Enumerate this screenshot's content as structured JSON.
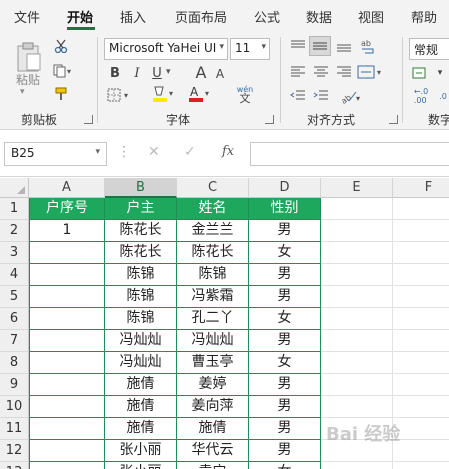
{
  "ribbon_tabs": [
    "文件",
    "开始",
    "插入",
    "页面布局",
    "公式",
    "数据",
    "视图",
    "帮助"
  ],
  "active_tab": "开始",
  "clipboard": {
    "paste_label": "粘贴",
    "group_label": "剪贴板"
  },
  "font": {
    "name": "Microsoft YaHei UI",
    "size": "11",
    "group_label": "字体",
    "bold": "B",
    "italic": "I",
    "underline": "U",
    "grow": "A",
    "shrink": "A",
    "phonetic": "wén"
  },
  "alignment": {
    "group_label": "对齐方式"
  },
  "number": {
    "format": "常规",
    "group_label": "数字"
  },
  "formula_bar": {
    "name_box": "B25",
    "formula": ""
  },
  "columns": [
    "A",
    "B",
    "C",
    "D",
    "E",
    "F"
  ],
  "selected_column": "B",
  "rows": [
    "1",
    "2",
    "3",
    "4",
    "5",
    "6",
    "7",
    "8",
    "9",
    "10",
    "11",
    "12",
    "13"
  ],
  "table": {
    "headers": [
      "户序号",
      "户主",
      "姓名",
      "性别"
    ],
    "body": [
      [
        "1",
        "陈花长",
        "金兰兰",
        "男"
      ],
      [
        "",
        "陈花长",
        "陈花长",
        "女"
      ],
      [
        "",
        "陈锦",
        "陈锦",
        "男"
      ],
      [
        "",
        "陈锦",
        "冯紫霜",
        "男"
      ],
      [
        "",
        "陈锦",
        "孔二丫",
        "女"
      ],
      [
        "",
        "冯灿灿",
        "冯灿灿",
        "男"
      ],
      [
        "",
        "冯灿灿",
        "曹玉亭",
        "女"
      ],
      [
        "",
        "施倩",
        "姜婷",
        "男"
      ],
      [
        "",
        "施倩",
        "姜向萍",
        "男"
      ],
      [
        "",
        "施倩",
        "施倩",
        "男"
      ],
      [
        "",
        "张小丽",
        "华代云",
        "男"
      ],
      [
        "",
        "张小丽",
        "袁宁",
        "女"
      ]
    ]
  },
  "watermark": "Bai 经验"
}
